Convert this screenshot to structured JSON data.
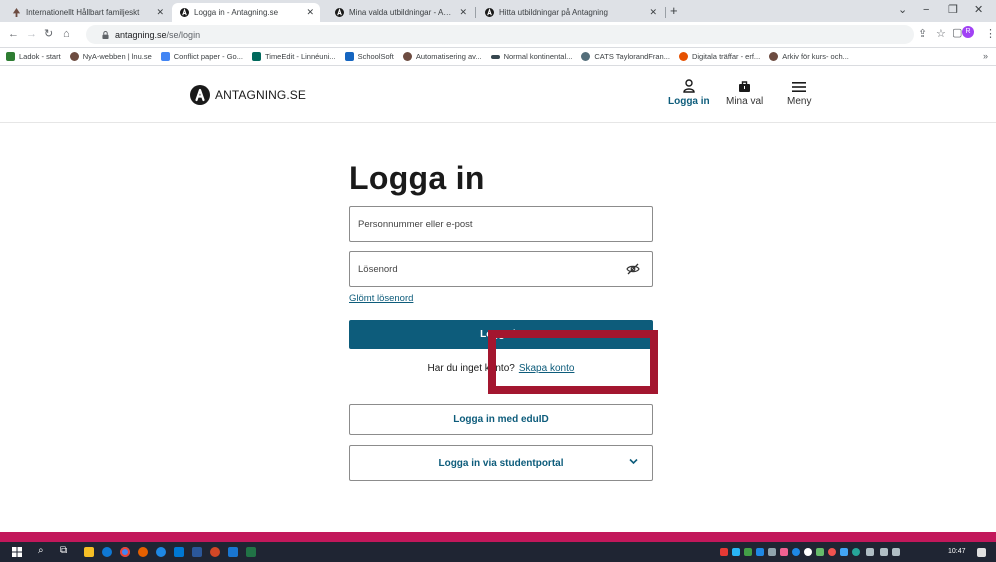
{
  "browser": {
    "tabs": [
      {
        "title": "Internationellt Hållbart familjeskt",
        "active": false
      },
      {
        "title": "Logga in - Antagning.se",
        "active": true
      },
      {
        "title": "Mina valda utbildningar - Antagn",
        "active": false
      },
      {
        "title": "Hitta utbildningar på Antagning",
        "active": false
      }
    ],
    "new_tab": "+",
    "url_host": "antagning.se",
    "url_path": "/se/login",
    "profile_initial": "R",
    "bookmarks": [
      {
        "label": "Ladok - start",
        "color": "#2e7d32"
      },
      {
        "label": "NyA-webben | lnu.se",
        "color": "#6d4c41"
      },
      {
        "label": "Conflict paper - Go...",
        "color": "#4285f4"
      },
      {
        "label": "TimeEdit - Linnéuni...",
        "color": "#00695c"
      },
      {
        "label": "SchoolSoft",
        "color": "#1565c0"
      },
      {
        "label": "Automatisering av...",
        "color": "#6d4c41"
      },
      {
        "label": "Normal kontinental...",
        "color": "#37474f"
      },
      {
        "label": "CATS TaylorandFran...",
        "color": "#546e7a"
      },
      {
        "label": "Digitala träffar - erf...",
        "color": "#e65100"
      },
      {
        "label": "Arkiv för kurs- och...",
        "color": "#6d4c41"
      }
    ],
    "bookmarks_more": "»"
  },
  "site": {
    "logo_text": "ANTAGNING.SE",
    "nav": {
      "login": "Logga in",
      "my_choices": "Mina val",
      "menu": "Meny"
    }
  },
  "login": {
    "title": "Logga in",
    "username_placeholder": "Personnummer eller e-post",
    "password_placeholder": "Lösenord",
    "forgot_password": "Glömt lösenord",
    "submit": "Logga in",
    "no_account_text": "Har du inget konto?",
    "create_account": "Skapa konto",
    "eduid_button": "Logga in med eduID",
    "student_portal_button": "Logga in via studentportal"
  },
  "taskbar": {
    "clock": "10:47"
  },
  "colors": {
    "brand": "#0d5c7b",
    "highlight": "#a3162f",
    "footer": "#c2185b"
  }
}
